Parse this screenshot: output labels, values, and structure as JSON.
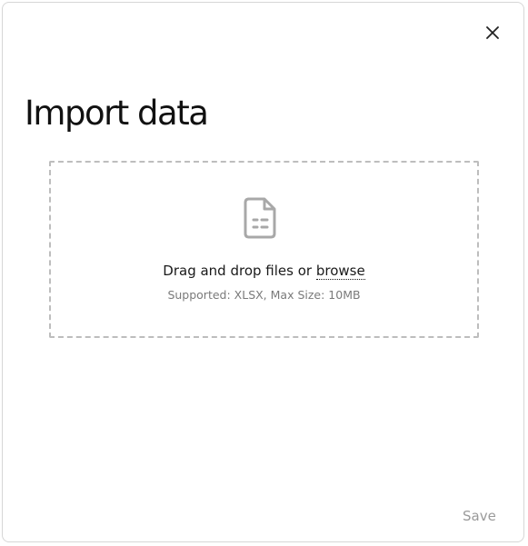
{
  "dialog": {
    "title": "Import data",
    "close_icon": "close-icon",
    "dropzone": {
      "icon": "file-spreadsheet-icon",
      "drop_text": "Drag and drop files or ",
      "browse_label": "browse",
      "supported_text": "Supported: XLSX, Max Size: 10MB"
    },
    "save_label": "Save"
  },
  "colors": {
    "title": "#111111",
    "icon": "#a8a8a8",
    "dropzone_border": "#bdbdbd",
    "muted_text": "#7a7a7a",
    "save_disabled": "#9a9a9a"
  }
}
